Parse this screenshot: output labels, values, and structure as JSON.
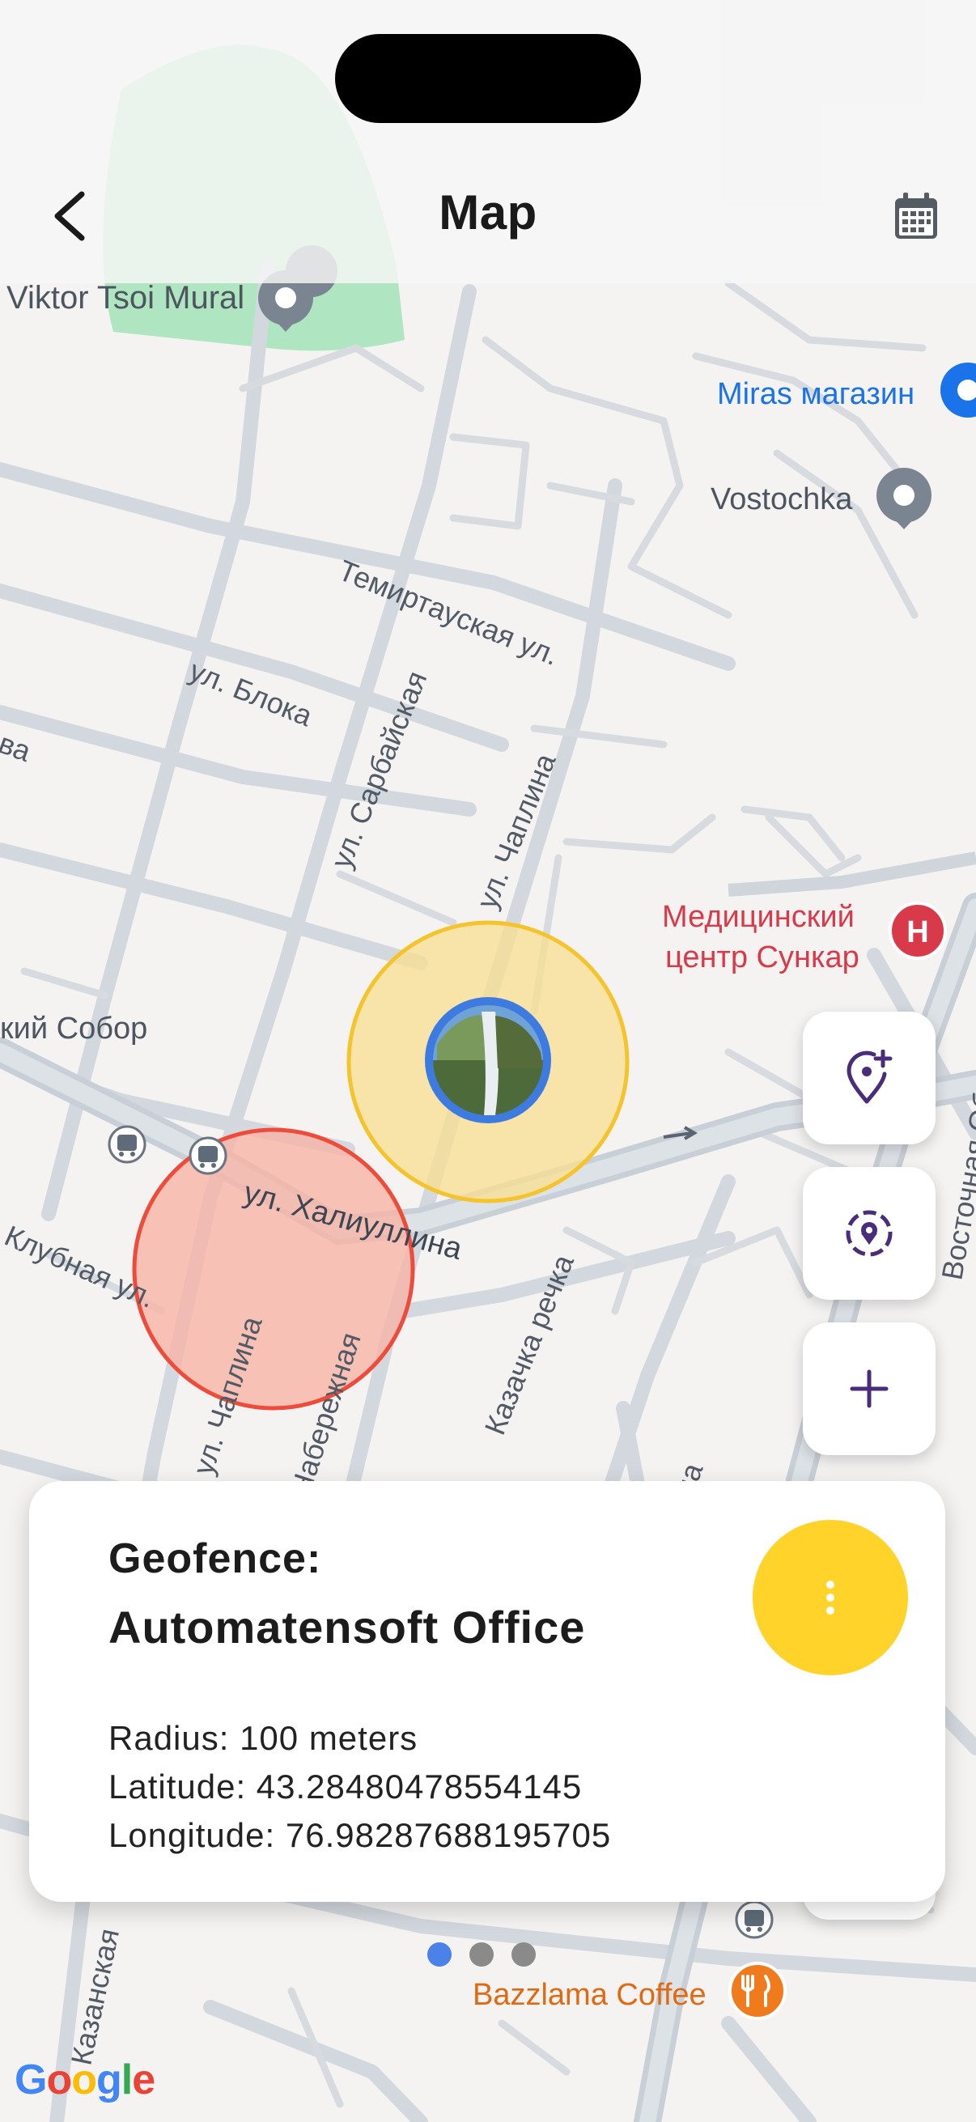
{
  "header": {
    "title": "Map"
  },
  "map": {
    "places": {
      "viktor": "Viktor Tsoi Mural",
      "miras": "Miras магазин",
      "vostochka": "Vostochka",
      "medical_line1": "Медицинский",
      "medical_line2": "центр Сункар",
      "sobor": "кий Собор",
      "bazzlama": "Bazzlama Coffee"
    },
    "roads": {
      "temirtau": "Темиртауская ул.",
      "bloka": "ул. Блока",
      "sarbayskaya": "ул. Сарбайская",
      "chaplina_upper": "ул. Чаплина",
      "khaliullina": "ул. Халиуллина",
      "klubnaya": "Клубная ул.",
      "chaplina_lower": "ул. Чаплина",
      "naberezhnaya": "Набережная",
      "kazachka": "Казачка речка",
      "kazanskaya": "Казанская",
      "vostochnaya": "Восточная Объ",
      "na": "на",
      "va": "ва"
    },
    "attribution": "Google"
  },
  "card": {
    "heading": "Geofence:",
    "name": "Automatensoft Office",
    "radius": "Radius: 100 meters",
    "latitude": "Latitude: 43.28480478554145",
    "longitude": "Longitude: 76.98287688195705"
  },
  "pager": {
    "count": 3,
    "active_index": 0
  },
  "fab_buttons": [
    "add-location-icon",
    "location-target-icon",
    "plus-icon"
  ],
  "colors": {
    "accent": "#ffd32a",
    "yellow_fence_fill": "#f9df8f",
    "yellow_fence_stroke": "#f5c32b",
    "red_fence_fill": "#f7b4a6",
    "red_fence_stroke": "#ef4b3a",
    "icon_purple": "#4a2d7a",
    "place_blue": "#1a73e8",
    "place_red": "#d93a4a",
    "place_orange": "#e06a12",
    "avatar_ring": "#3d7be0"
  }
}
